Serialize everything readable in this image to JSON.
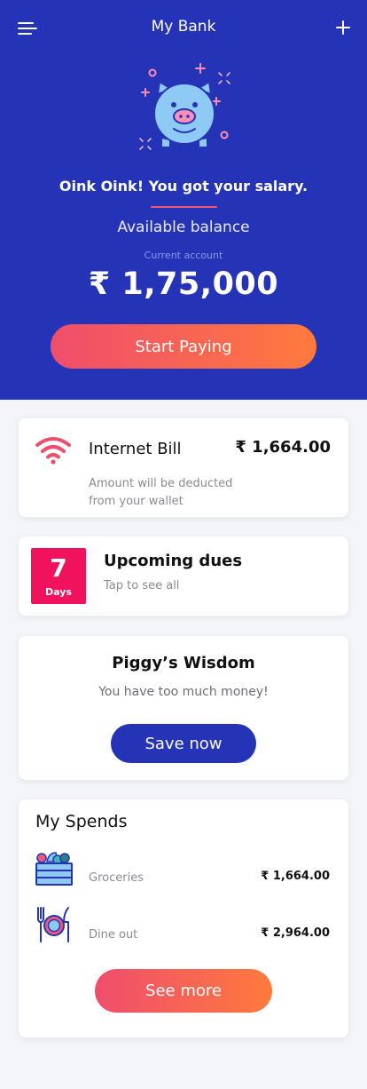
{
  "header": {
    "title": "My Bank",
    "menu_icon": "menu-icon",
    "add_icon": "plus-icon"
  },
  "hero": {
    "illustration": "piggy-bank-icon",
    "message": "Oink Oink! You got your salary.",
    "balance_label": "Available balance",
    "account_label": "Current account",
    "balance": "₹ 1,75,000",
    "cta_label": "Start Paying"
  },
  "bill": {
    "icon": "wifi-icon",
    "title": "Internet Bill",
    "amount": "₹ 1,664.00",
    "note": "Amount will be deducted from your wallet"
  },
  "dues": {
    "days": "7",
    "days_label": "Days",
    "title": "Upcoming dues",
    "subtitle": "Tap to see all"
  },
  "wisdom": {
    "title": "Piggy’s Wisdom",
    "text": "You have too much money!",
    "button_label": "Save now"
  },
  "spends": {
    "title": "My Spends",
    "items": [
      {
        "icon": "groceries-icon",
        "label": "Groceries",
        "amount": "₹ 1,664.00"
      },
      {
        "icon": "dine-out-icon",
        "label": "Dine out",
        "amount": "₹ 2,964.00"
      }
    ],
    "button_label": "See more"
  },
  "colors": {
    "primary": "#2534b7",
    "accent_start": "#ef4d6c",
    "accent_end": "#ff7a3d",
    "dues_badge": "#f0125c"
  }
}
